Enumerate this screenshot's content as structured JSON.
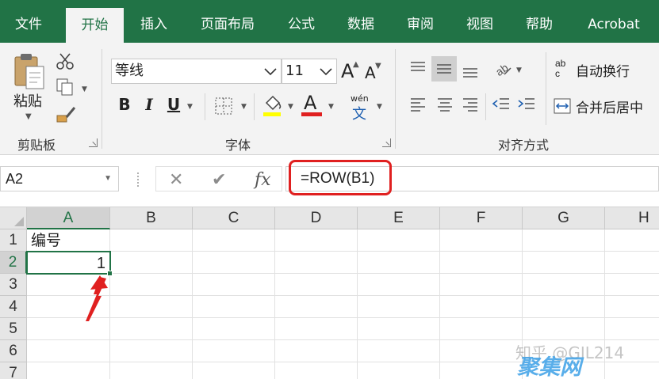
{
  "tabs": [
    {
      "label": "文件"
    },
    {
      "label": "开始",
      "active": true
    },
    {
      "label": "插入"
    },
    {
      "label": "页面布局"
    },
    {
      "label": "公式"
    },
    {
      "label": "数据"
    },
    {
      "label": "审阅"
    },
    {
      "label": "视图"
    },
    {
      "label": "帮助"
    },
    {
      "label": "Acrobat"
    }
  ],
  "ribbon": {
    "clipboard": {
      "paste_label": "粘贴",
      "group_label": "剪贴板"
    },
    "font": {
      "font_name": "等线",
      "font_size": "11",
      "bold": "B",
      "italic": "I",
      "underline": "U",
      "grow": "A",
      "shrink": "A",
      "font_color_letter": "A",
      "phonetic_top": "wén",
      "phonetic_bottom": "文",
      "group_label": "字体",
      "highlight_color": "#ffff00",
      "font_color": "#e02020"
    },
    "alignment": {
      "wrap_text": "自动换行",
      "merge_center": "合并后居中",
      "wrap_icon_top": "ab",
      "wrap_icon_bottom": "c",
      "group_label": "对齐方式"
    }
  },
  "formula_bar": {
    "name_box": "A2",
    "formula": "=ROW(B1)",
    "cancel_icon": "✕",
    "enter_icon": "✔",
    "fx_label": "fx"
  },
  "sheet": {
    "columns": [
      "A",
      "B",
      "C",
      "D",
      "E",
      "F",
      "G",
      "H"
    ],
    "rows": [
      "1",
      "2",
      "3",
      "4",
      "5",
      "6",
      "7"
    ],
    "selected_column": "A",
    "selected_row": "2",
    "cells": {
      "A1": "编号",
      "A2": "1"
    }
  },
  "annotations": {
    "highlight_color": "#e02020",
    "accent_color": "#217346"
  },
  "watermark": {
    "line1": "知乎 @GIL214",
    "line2": "聚集网"
  }
}
